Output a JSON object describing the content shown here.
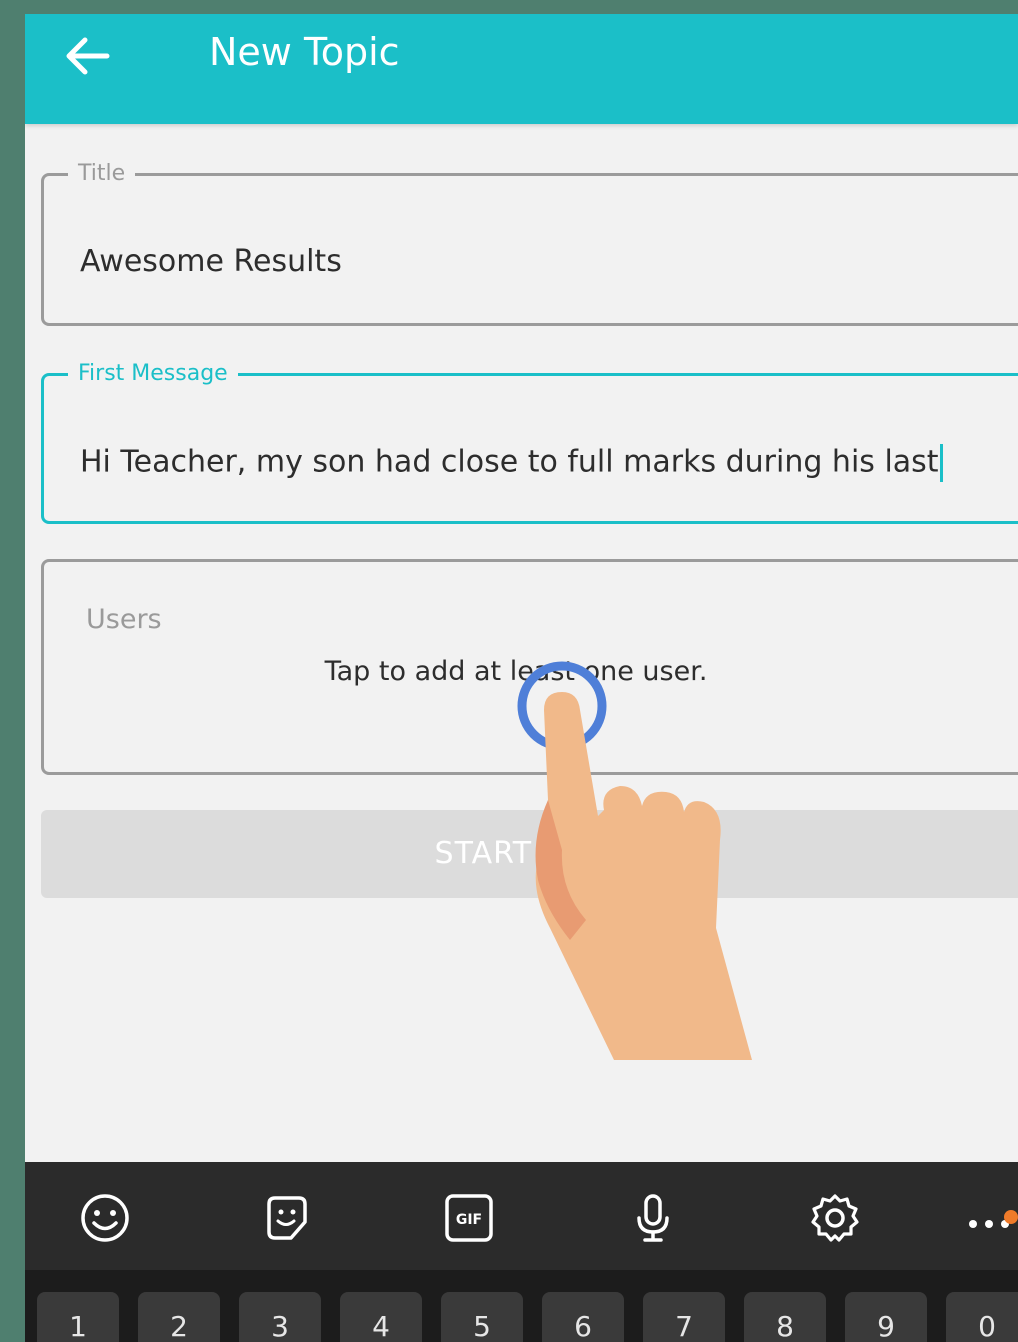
{
  "appbar": {
    "title": "New Topic",
    "back_icon": "arrow-left-icon",
    "background": "#1bbfc8"
  },
  "form": {
    "title_field": {
      "label": "Title",
      "value": "Awesome Results"
    },
    "message_field": {
      "label": "First Message",
      "value": "Hi Teacher, my son had close to full marks during his last",
      "focused": true
    },
    "users": {
      "label": "Users",
      "hint": "Tap to add at least one user."
    },
    "start_button": {
      "label": "START TOPIC",
      "enabled": false
    }
  },
  "keyboard": {
    "toolbar_icons": [
      "emoji-icon",
      "sticker-icon",
      "gif-icon",
      "microphone-icon",
      "settings-icon",
      "more-icon"
    ],
    "number_keys": [
      "1",
      "2",
      "3",
      "4",
      "5",
      "6",
      "7",
      "8",
      "9",
      "0"
    ]
  },
  "overlay": {
    "gesture": "tap-hand-pointer-icon"
  },
  "colors": {
    "accent": "#1bbfc8",
    "tap_ring": "#4f7fd8",
    "hand": "#f1b98a",
    "notify": "#f07b2a"
  }
}
